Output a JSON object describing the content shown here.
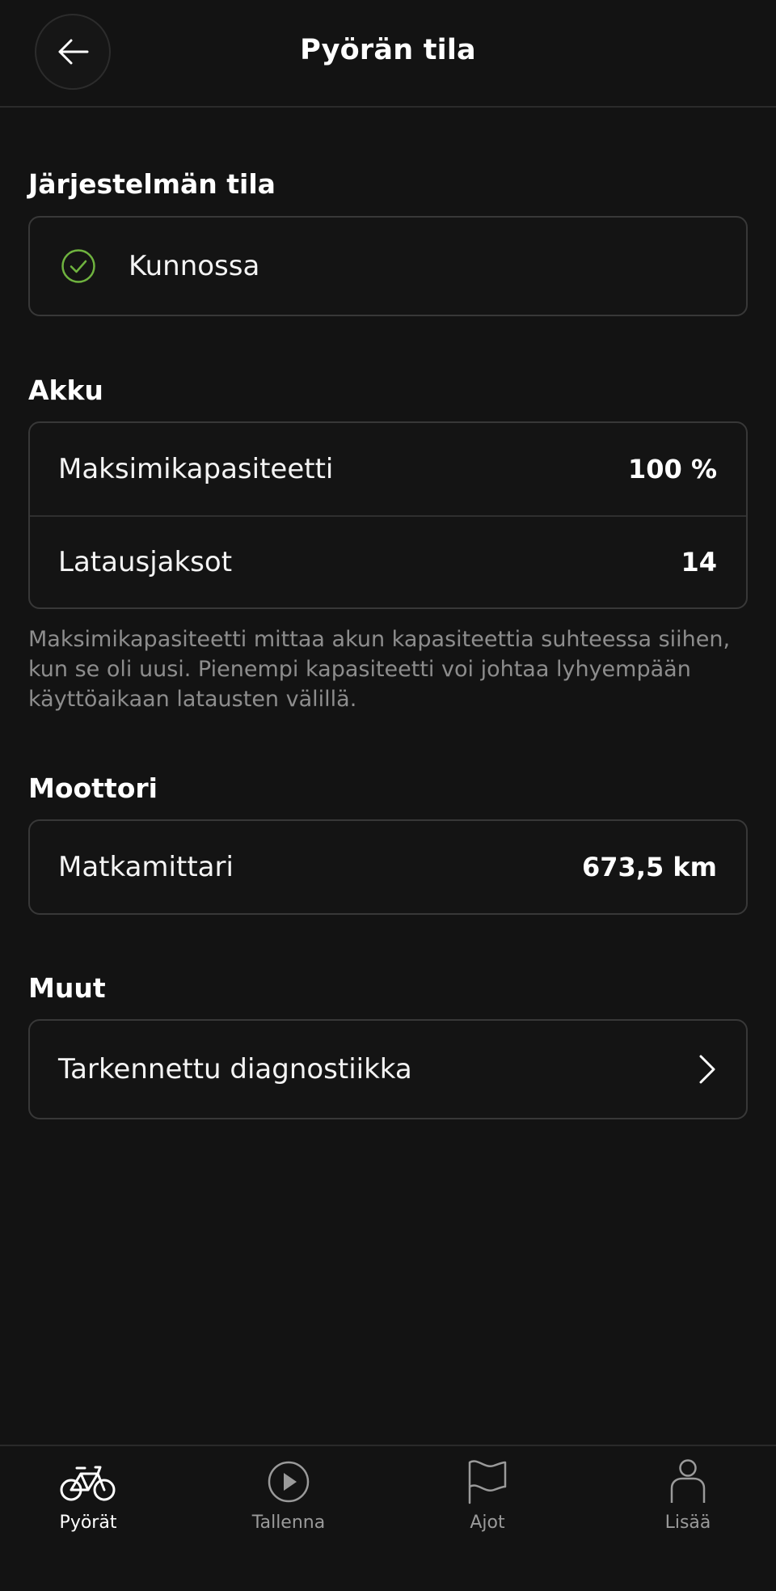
{
  "header": {
    "title": "Pyörän tila"
  },
  "system": {
    "title": "Järjestelmän tila",
    "status": "Kunnossa",
    "status_color": "#6fb33f"
  },
  "battery": {
    "title": "Akku",
    "rows": [
      {
        "label": "Maksimikapasiteetti",
        "value": "100 %"
      },
      {
        "label": "Latausjaksot",
        "value": "14"
      }
    ],
    "note": "Maksimikapasiteetti mittaa akun kapasiteettia suhteessa siihen, kun se oli uusi. Pienempi kapasiteetti voi johtaa lyhyempään käyttöaikaan latausten välillä."
  },
  "motor": {
    "title": "Moottori",
    "rows": [
      {
        "label": "Matkamittari",
        "value": "673,5 km"
      }
    ]
  },
  "other": {
    "title": "Muut",
    "rows": [
      {
        "label": "Tarkennettu diagnostiikka"
      }
    ]
  },
  "tabbar": {
    "tabs": [
      {
        "label": "Pyörät",
        "icon": "bike-icon",
        "active": true
      },
      {
        "label": "Tallenna",
        "icon": "play-icon",
        "active": false
      },
      {
        "label": "Ajot",
        "icon": "flag-icon",
        "active": false
      },
      {
        "label": "Lisää",
        "icon": "person-icon",
        "active": false
      }
    ]
  }
}
